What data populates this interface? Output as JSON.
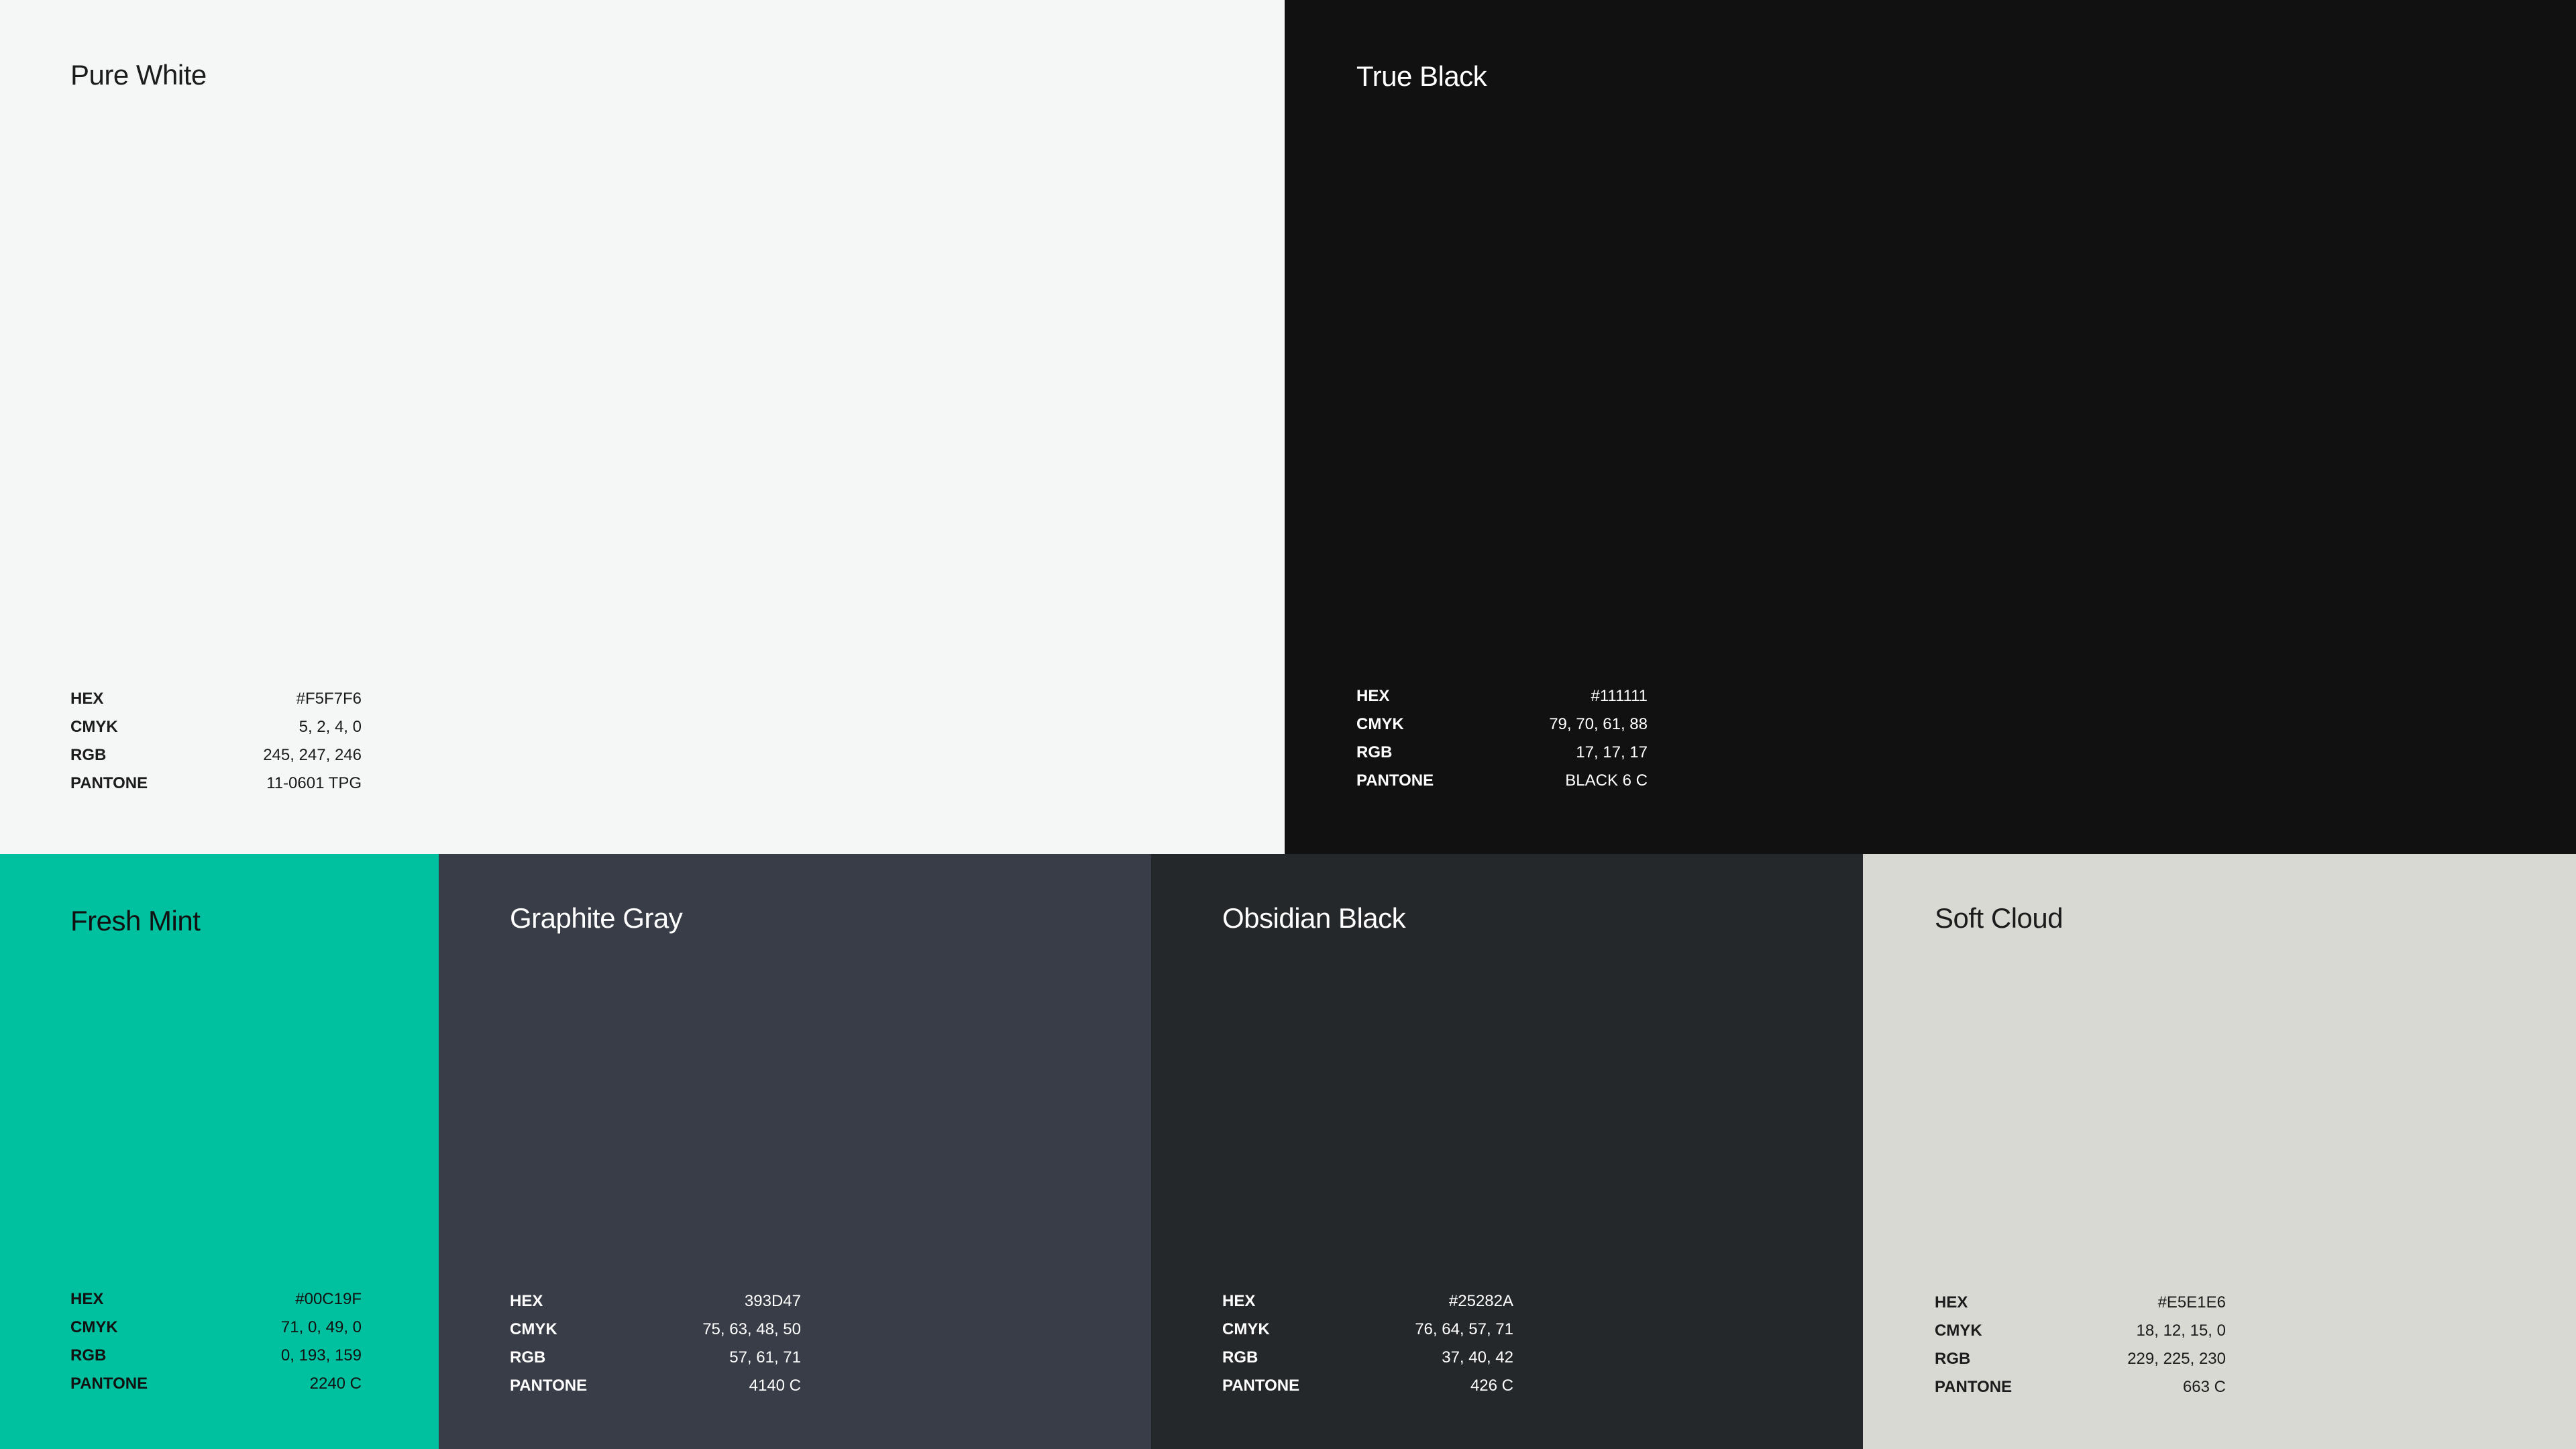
{
  "labels": {
    "hex": "HEX",
    "cmyk": "CMYK",
    "rgb": "RGB",
    "pantone": "PANTONE"
  },
  "swatches": [
    {
      "name": "Pure White",
      "hex": "#F5F7F6",
      "cmyk": "5, 2, 4, 0",
      "rgb": "245, 247, 246",
      "pantone": "11-0601 TPG",
      "fill": "#F5F7F6",
      "text_color": "#1C1C1C"
    },
    {
      "name": "True Black",
      "hex": "#111111",
      "cmyk": "79, 70, 61, 88",
      "rgb": "17, 17, 17",
      "pantone": "BLACK 6 C",
      "fill": "#111111",
      "text_color": "#FFFFFF"
    },
    {
      "name": "Fresh Mint",
      "hex": "#00C19F",
      "cmyk": "71, 0, 49, 0",
      "rgb": "0, 193, 159",
      "pantone": "2240 C",
      "fill": "#00C19F",
      "text_color": "#111111"
    },
    {
      "name": "Graphite Gray",
      "hex": "393D47",
      "cmyk": "75, 63, 48, 50",
      "rgb": "57, 61, 71",
      "pantone": "4140 C",
      "fill": "#393D47",
      "text_color": "#FFFFFF"
    },
    {
      "name": "Obsidian Black",
      "hex": "#25282A",
      "cmyk": "76, 64, 57, 71",
      "rgb": "37, 40, 42",
      "pantone": "426 C",
      "fill": "#25282A",
      "text_color": "#FFFFFF"
    },
    {
      "name": "Soft Cloud",
      "hex": "#E5E1E6",
      "cmyk": "18, 12, 15, 0",
      "rgb": "229, 225, 230",
      "pantone": "663 C",
      "fill": "#D9D9D4",
      "text_color": "#1C1C1C"
    }
  ]
}
